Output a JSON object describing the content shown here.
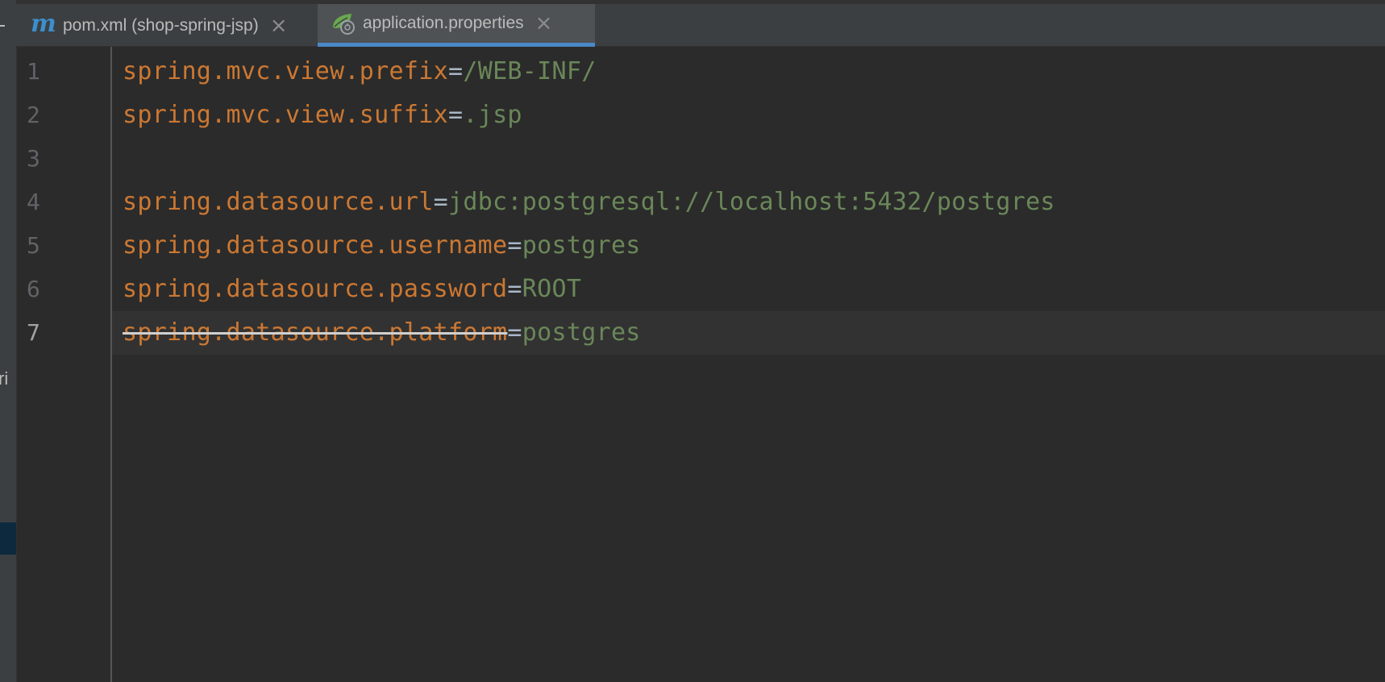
{
  "tabs": [
    {
      "label": "pom.xml (shop-spring-jsp)",
      "icon": "maven-icon",
      "active": false
    },
    {
      "label": "application.properties",
      "icon": "spring-boot-icon",
      "active": true
    }
  ],
  "left_panel": {
    "partial_text": "ri"
  },
  "editor": {
    "current_line": 7,
    "lines": [
      {
        "num": "1",
        "key": "spring.mvc.view.prefix",
        "eq": "=",
        "value": "/WEB-INF/",
        "deprecated": false
      },
      {
        "num": "2",
        "key": "spring.mvc.view.suffix",
        "eq": "=",
        "value": ".jsp",
        "deprecated": false
      },
      {
        "num": "3",
        "key": "",
        "eq": "",
        "value": "",
        "deprecated": false
      },
      {
        "num": "4",
        "key": "spring.datasource.url",
        "eq": "=",
        "value": "jdbc:postgresql://localhost:5432/postgres",
        "deprecated": false
      },
      {
        "num": "5",
        "key": "spring.datasource.username",
        "eq": "=",
        "value": "postgres",
        "deprecated": false
      },
      {
        "num": "6",
        "key": "spring.datasource.password",
        "eq": "=",
        "value": "ROOT",
        "deprecated": false
      },
      {
        "num": "7",
        "key": "spring.datasource.platform",
        "eq": "=",
        "value": "postgres",
        "deprecated": true
      }
    ]
  },
  "colors": {
    "key": "#cc7832",
    "value": "#6a8759",
    "accent": "#4a88c7"
  }
}
